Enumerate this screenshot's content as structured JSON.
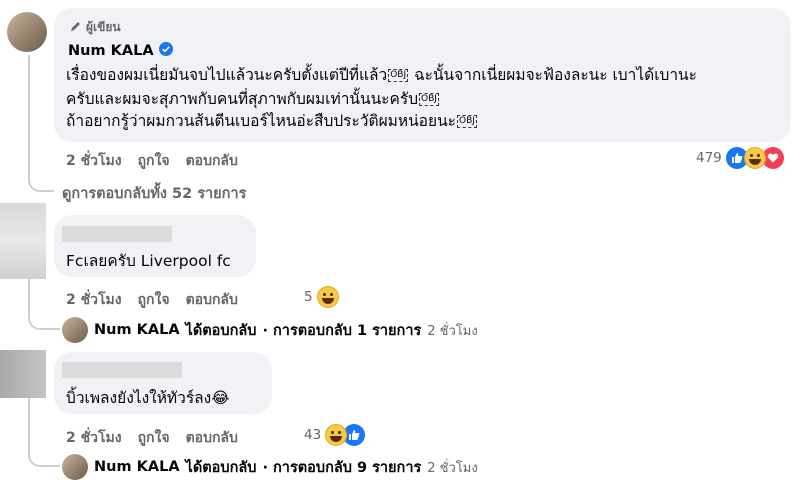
{
  "main_comment": {
    "author_badge": "ผู้เขียน",
    "author": "Num KALA",
    "lines": [
      "เรื่องของผมเนี่ยมันจบไปแล้วนะครับตั้งแต่ปีที่แล้ว",
      "ฉะนั้นจากเนี่ยผมจะฟ้องละนะ เบาได้เบานะ",
      "ครับและผมจะสุภาพกับคนที่สุภาพกับผมเท่านั้นนะครับ",
      "ถ้าอยากรู้ว่าผมกวนส้นตีนเบอร์ไหนอ่ะสืบประวัติผมหน่อยนะ"
    ],
    "obj_glyph": "OBJ",
    "time": "2 ชั่วโมง",
    "like": "ถูกใจ",
    "reply": "ตอบกลับ",
    "reaction_count": "479",
    "view_replies": "ดูการตอบกลับทั้ง 52 รายการ"
  },
  "comments": [
    {
      "text": "Fcเลยครับ Liverpool fc",
      "time": "2 ชั่วโมง",
      "like": "ถูกใจ",
      "reply": "ตอบกลับ",
      "reaction_count": "5",
      "reply_summary": {
        "author": "Num KALA",
        "action": "ได้ตอบกลับ",
        "count_text": "· การตอบกลับ 1 รายการ",
        "time": "2 ชั่วโมง"
      }
    },
    {
      "text": "บิ้วเพลงยังไงให้ทัวร์ลง😂",
      "time": "2 ชั่วโมง",
      "like": "ถูกใจ",
      "reply": "ตอบกลับ",
      "reaction_count": "43",
      "reply_summary": {
        "author": "Num KALA",
        "action": "ได้ตอบกลับ",
        "count_text": "· การตอบกลับ 9 รายการ",
        "time": "2 ชั่วโมง"
      }
    }
  ],
  "colors": {
    "bubble": "#f0f2f5",
    "meta": "#65676b",
    "like_blue": "#1877f2",
    "love_red": "#f33e58",
    "haha_yellow": "#f7c948"
  }
}
